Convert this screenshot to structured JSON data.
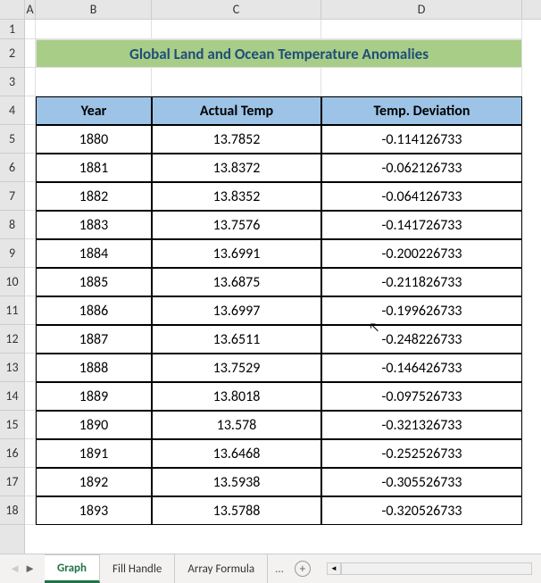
{
  "columns": [
    "A",
    "B",
    "C",
    "D"
  ],
  "row_numbers": [
    1,
    2,
    3,
    4,
    5,
    6,
    7,
    8,
    9,
    10,
    11,
    12,
    13,
    14,
    15,
    16,
    17,
    18
  ],
  "title": "Global Land and Ocean Temperature Anomalies",
  "headers": {
    "year": "Year",
    "actual": "Actual Temp",
    "dev": "Temp. Deviation"
  },
  "rows": [
    {
      "year": "1880",
      "actual": "13.7852",
      "dev": "-0.114126733"
    },
    {
      "year": "1881",
      "actual": "13.8372",
      "dev": "-0.062126733"
    },
    {
      "year": "1882",
      "actual": "13.8352",
      "dev": "-0.064126733"
    },
    {
      "year": "1883",
      "actual": "13.7576",
      "dev": "-0.141726733"
    },
    {
      "year": "1884",
      "actual": "13.6991",
      "dev": "-0.200226733"
    },
    {
      "year": "1885",
      "actual": "13.6875",
      "dev": "-0.211826733"
    },
    {
      "year": "1886",
      "actual": "13.6997",
      "dev": "-0.199626733"
    },
    {
      "year": "1887",
      "actual": "13.6511",
      "dev": "-0.248226733"
    },
    {
      "year": "1888",
      "actual": "13.7529",
      "dev": "-0.146426733"
    },
    {
      "year": "1889",
      "actual": "13.8018",
      "dev": "-0.097526733"
    },
    {
      "year": "1890",
      "actual": "13.578",
      "dev": "-0.321326733"
    },
    {
      "year": "1891",
      "actual": "13.6468",
      "dev": "-0.252526733"
    },
    {
      "year": "1892",
      "actual": "13.5938",
      "dev": "-0.305526733"
    },
    {
      "year": "1893",
      "actual": "13.5788",
      "dev": "-0.320526733"
    }
  ],
  "tabs": {
    "t1": "Graph",
    "t2": "Fill Handle",
    "t3": "Array Formula",
    "more": "..."
  }
}
